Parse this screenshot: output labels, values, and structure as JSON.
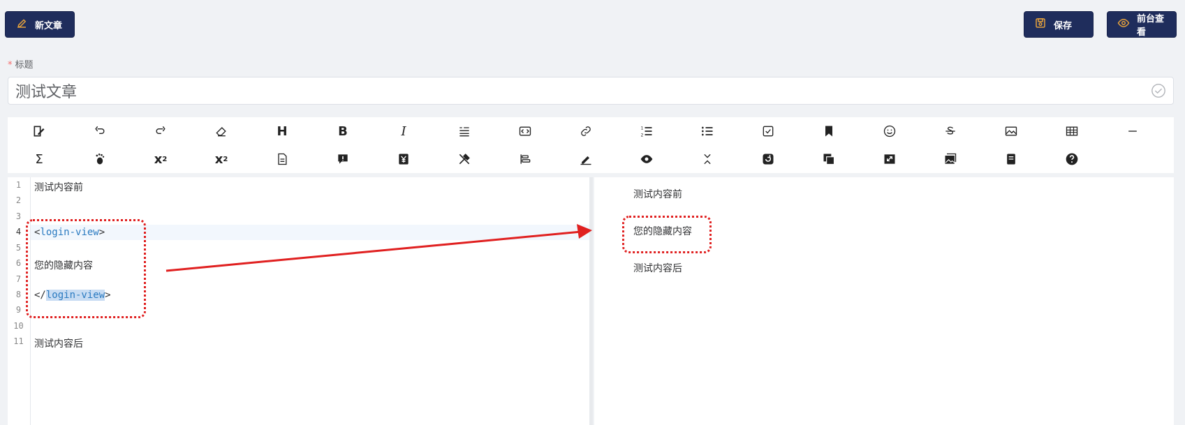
{
  "header": {
    "new_article": "新文章",
    "save": "保存",
    "view_frontend": "前台查看"
  },
  "title_field": {
    "required_mark": "*",
    "label": "标题",
    "value": "测试文章"
  },
  "toolbar": {
    "row1": [
      "edit-mode",
      "undo",
      "redo",
      "eraser",
      "header",
      "bold",
      "italic",
      "quote",
      "code",
      "link",
      "ordered-list",
      "unordered-list",
      "checklist",
      "bookmark",
      "emoji",
      "strikethrough",
      "image",
      "table",
      "horizontal-rule"
    ],
    "row2": [
      "formula",
      "footnote",
      "superscript",
      "subscript",
      "file",
      "warning",
      "yen",
      "tools",
      "align",
      "pen",
      "preview",
      "fold",
      "refresh",
      "copy",
      "fullscreen",
      "gallery",
      "note",
      "help"
    ]
  },
  "editor": {
    "lines": [
      {
        "n": "1",
        "text": "测试内容前"
      },
      {
        "n": "2",
        "text": ""
      },
      {
        "n": "3",
        "text": ""
      },
      {
        "n": "4",
        "open_lt": "<",
        "tag": "login-view",
        "open_gt": ">"
      },
      {
        "n": "5",
        "text": ""
      },
      {
        "n": "6",
        "text": "您的隐藏内容"
      },
      {
        "n": "7",
        "text": ""
      },
      {
        "n": "8",
        "close_lt": "</",
        "tag": "login-view",
        "close_gt": ">"
      },
      {
        "n": "9",
        "text": ""
      },
      {
        "n": "10",
        "text": ""
      },
      {
        "n": "11",
        "text": "测试内容后"
      }
    ]
  },
  "preview": {
    "before": "测试内容前",
    "hidden": "您的隐藏内容",
    "after": "测试内容后"
  },
  "colors": {
    "primary_button": "#1f2d5c",
    "annotation": "#e02020",
    "accent_icon": "#e6a23c"
  }
}
